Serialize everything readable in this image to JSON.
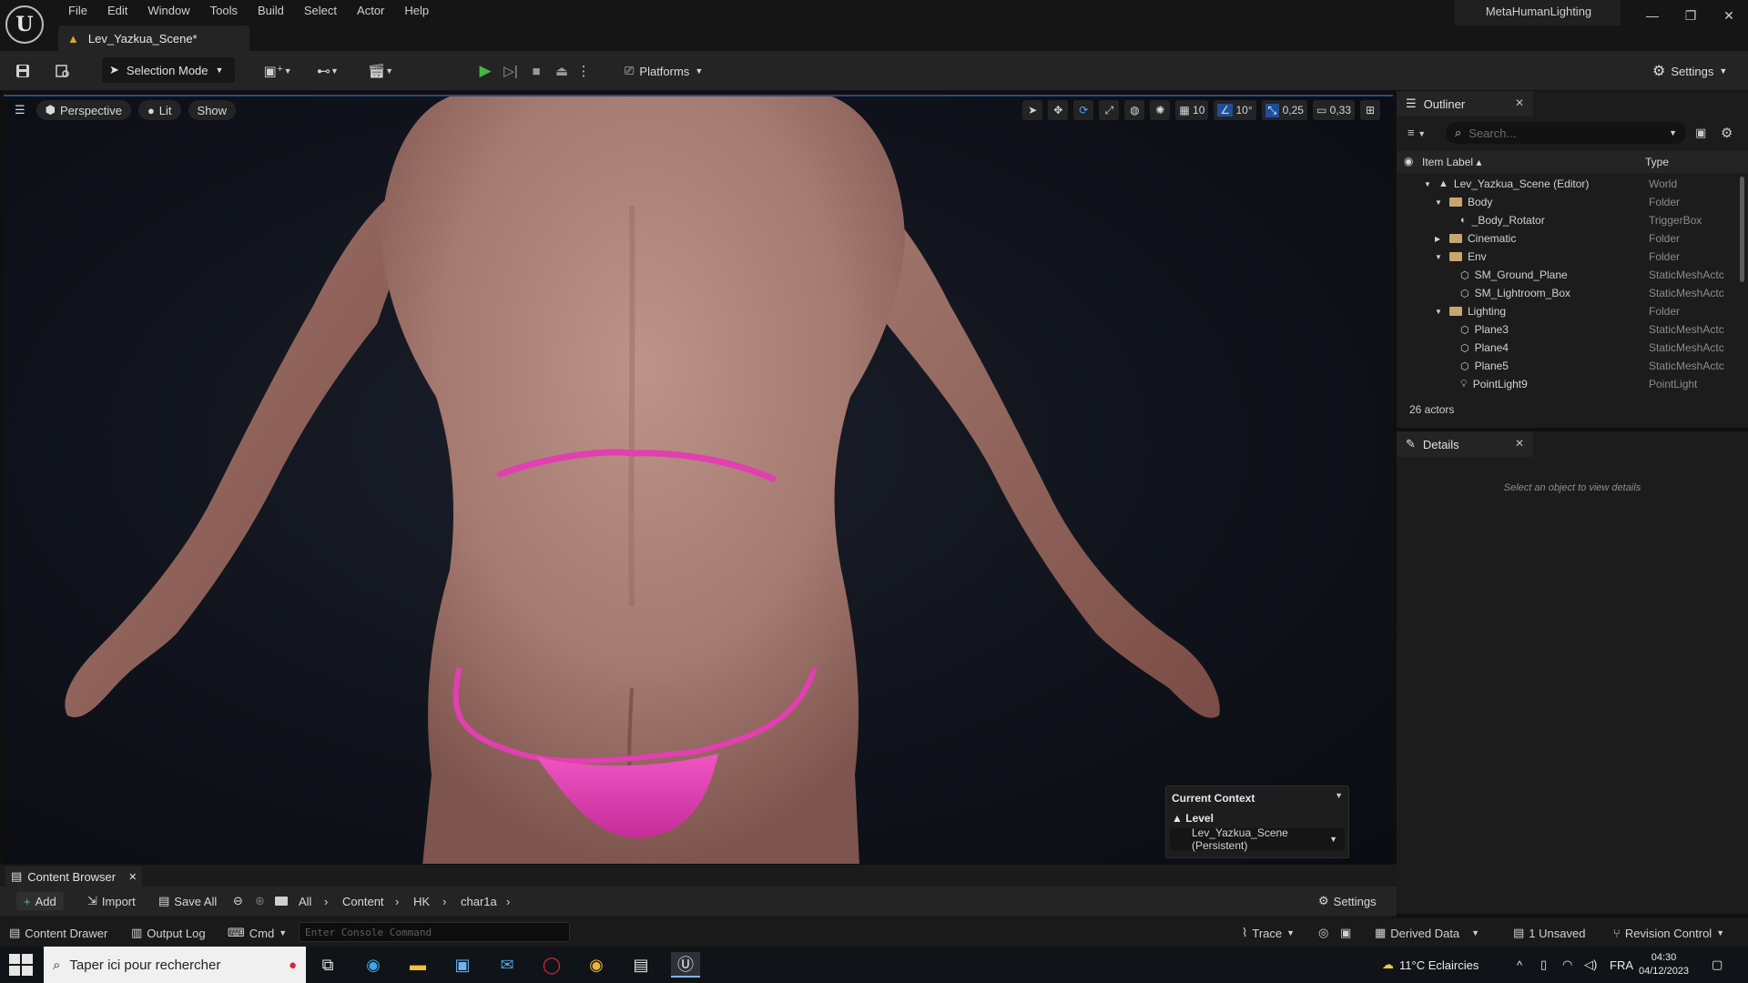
{
  "app": {
    "project_name": "MetaHumanLighting",
    "document_tab": "Lev_Yazkua_Scene*"
  },
  "menu": [
    "File",
    "Edit",
    "Window",
    "Tools",
    "Build",
    "Select",
    "Actor",
    "Help"
  ],
  "toolbar": {
    "selection_mode": "Selection Mode",
    "platforms": "Platforms",
    "settings": "Settings"
  },
  "viewport": {
    "perspective": "Perspective",
    "lit": "Lit",
    "show": "Show",
    "grid_size": "10",
    "rotation_snap": "10°",
    "scale_snap": "0,25",
    "camera_speed": "0,33"
  },
  "current_context": {
    "title": "Current Context",
    "level_label": "Level",
    "level_value": "Lev_Yazkua_Scene (Persistent)"
  },
  "outliner": {
    "tab_label": "Outliner",
    "search_placeholder": "Search...",
    "col_label": "Item Label",
    "col_type": "Type",
    "rows": [
      {
        "label": "Lev_Yazkua_Scene (Editor)",
        "type": "World",
        "icon": "level-icon",
        "depth": 0,
        "expander": "down"
      },
      {
        "label": "Body",
        "type": "Folder",
        "icon": "folder-icon",
        "depth": 1,
        "expander": "down"
      },
      {
        "label": "_Body_Rotator",
        "type": "TriggerBox",
        "icon": "triggerbox-icon",
        "depth": 2,
        "expander": ""
      },
      {
        "label": "Cinematic",
        "type": "Folder",
        "icon": "folder-icon",
        "depth": 1,
        "expander": "right"
      },
      {
        "label": "Env",
        "type": "Folder",
        "icon": "folder-icon",
        "depth": 1,
        "expander": "down"
      },
      {
        "label": "SM_Ground_Plane",
        "type": "StaticMeshActc",
        "icon": "static-mesh-icon",
        "depth": 2,
        "expander": ""
      },
      {
        "label": "SM_Lightroom_Box",
        "type": "StaticMeshActc",
        "icon": "static-mesh-icon",
        "depth": 2,
        "expander": ""
      },
      {
        "label": "Lighting",
        "type": "Folder",
        "icon": "folder-icon",
        "depth": 1,
        "expander": "down"
      },
      {
        "label": "Plane3",
        "type": "StaticMeshActc",
        "icon": "static-mesh-icon",
        "depth": 2,
        "expander": ""
      },
      {
        "label": "Plane4",
        "type": "StaticMeshActc",
        "icon": "static-mesh-icon",
        "depth": 2,
        "expander": ""
      },
      {
        "label": "Plane5",
        "type": "StaticMeshActc",
        "icon": "static-mesh-icon",
        "depth": 2,
        "expander": ""
      },
      {
        "label": "PointLight9",
        "type": "PointLight",
        "icon": "point-light-icon",
        "depth": 2,
        "expander": ""
      }
    ],
    "actor_count": "26 actors"
  },
  "details": {
    "tab_label": "Details",
    "hint": "Select an object to view details"
  },
  "content_browser": {
    "tab_label": "Content Browser",
    "add": "Add",
    "import": "Import",
    "save_all": "Save All",
    "breadcrumb": [
      "All",
      "Content",
      "HK",
      "char1a"
    ],
    "settings": "Settings"
  },
  "statusbar": {
    "content_drawer": "Content Drawer",
    "output_log": "Output Log",
    "cmd": "Cmd",
    "console_placeholder": "Enter Console Command",
    "trace": "Trace",
    "derived_data": "Derived Data",
    "unsaved": "1 Unsaved",
    "revision_control": "Revision Control"
  },
  "taskbar": {
    "search_text": "Taper ici pour rechercher",
    "weather": "11°C Eclaircies",
    "language": "FRA",
    "time": "04:30",
    "date": "04/12/2023"
  },
  "colors": {
    "accent_blue": "#4aa3ff",
    "play_green": "#47b54a",
    "garment_pink": "#e23fb0",
    "skin_tone": "#b48a80"
  }
}
